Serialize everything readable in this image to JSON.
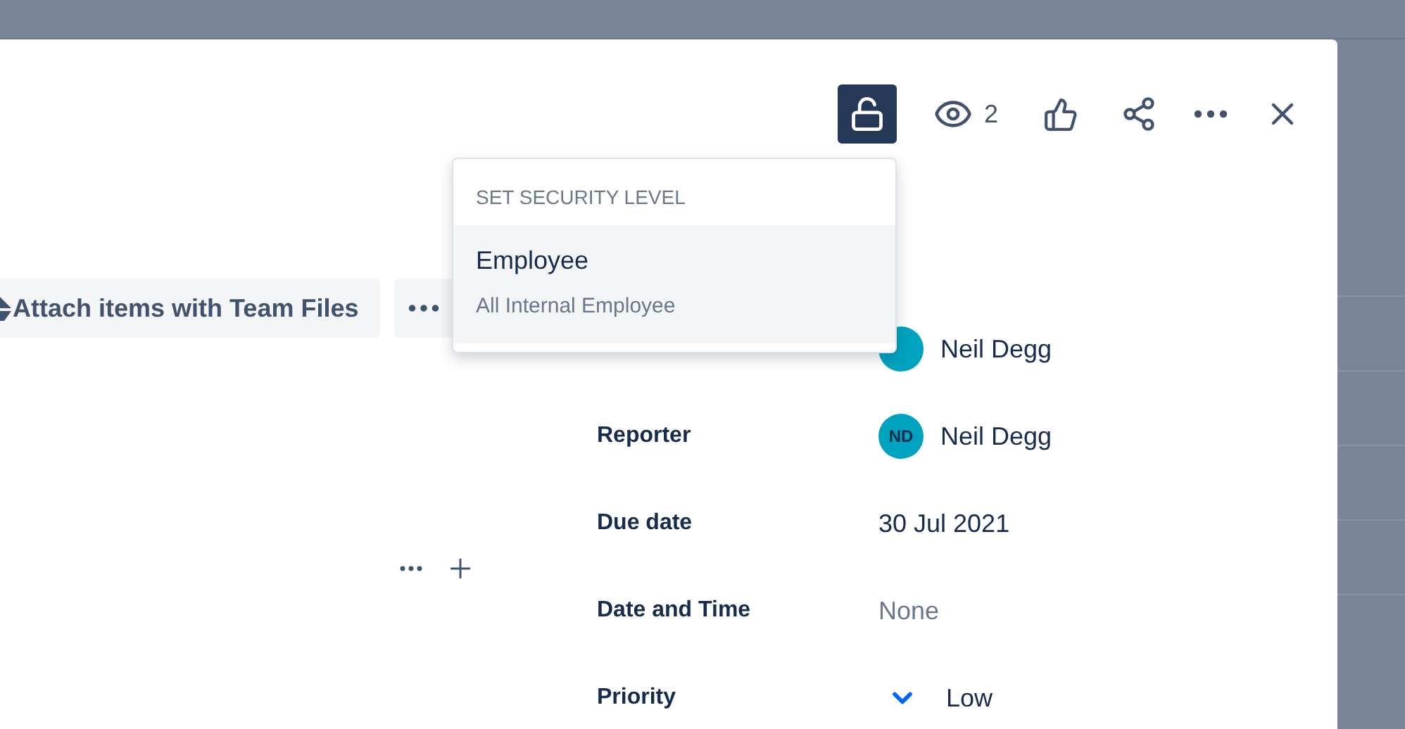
{
  "header": {
    "security": {
      "selected": true
    },
    "watchers": {
      "count": "2"
    }
  },
  "attach": {
    "label": "Attach items with Team Files"
  },
  "fields": [
    {
      "kind": "person",
      "value": "Neil Degg",
      "color": "#00a3bf"
    },
    {
      "label": "Reporter",
      "kind": "person",
      "initials": "ND",
      "value": "Neil Degg",
      "color": "#00a3bf"
    },
    {
      "label": "Due date",
      "kind": "text",
      "value": "30 Jul 2021"
    },
    {
      "label": "Date and Time",
      "kind": "empty",
      "value": "None"
    },
    {
      "label": "Priority",
      "kind": "priority",
      "value": "Low"
    }
  ],
  "security_menu": {
    "heading": "SET SECURITY LEVEL",
    "items": [
      {
        "title": "Employee",
        "description": "All Internal Employee"
      }
    ]
  }
}
